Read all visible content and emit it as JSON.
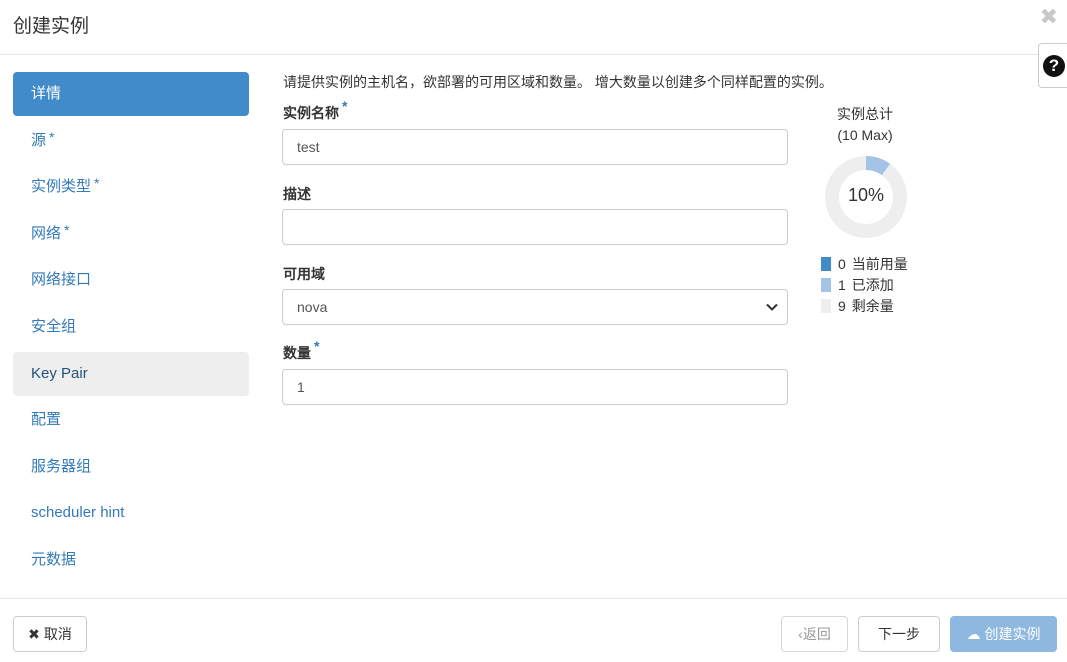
{
  "header": {
    "title": "创建实例",
    "close_symbol": "✖",
    "help_symbol": "?"
  },
  "nav": {
    "items": [
      {
        "label": "详情",
        "required": false,
        "state": "active"
      },
      {
        "label": "源",
        "required": true,
        "state": "normal"
      },
      {
        "label": "实例类型",
        "required": true,
        "state": "normal"
      },
      {
        "label": "网络",
        "required": true,
        "state": "normal"
      },
      {
        "label": "网络接口",
        "required": false,
        "state": "normal"
      },
      {
        "label": "安全组",
        "required": false,
        "state": "normal"
      },
      {
        "label": "Key Pair",
        "required": false,
        "state": "highlight"
      },
      {
        "label": "配置",
        "required": false,
        "state": "normal"
      },
      {
        "label": "服务器组",
        "required": false,
        "state": "normal"
      },
      {
        "label": "scheduler hint",
        "required": false,
        "state": "normal"
      },
      {
        "label": "元数据",
        "required": false,
        "state": "normal"
      }
    ],
    "required_mark": "*"
  },
  "form": {
    "intro": "请提供实例的主机名，欲部署的可用区域和数量。 增大数量以创建多个同样配置的实例。",
    "instance_name": {
      "label": "实例名称",
      "required": true,
      "value": "test"
    },
    "description": {
      "label": "描述",
      "required": false,
      "value": ""
    },
    "availability_zone": {
      "label": "可用域",
      "required": false,
      "value": "nova"
    },
    "count": {
      "label": "数量",
      "required": true,
      "value": "1"
    }
  },
  "quota": {
    "title": "实例总计",
    "max_text": "(10 Max)",
    "percent_text": "10%",
    "used_fraction": 0.0,
    "added_fraction": 0.1,
    "legend": [
      {
        "count": "0",
        "label": "当前用量",
        "color": "#428bca"
      },
      {
        "count": "1",
        "label": "已添加",
        "color": "#a3c4e6"
      },
      {
        "count": "9",
        "label": "剩余量",
        "color": "#eeeeee"
      }
    ]
  },
  "footer": {
    "cancel_label": "取消",
    "cancel_icon": "✖",
    "back_label": "‹返回",
    "next_label": "下一步",
    "launch_label": "创建实例",
    "launch_icon": "☁"
  },
  "colors": {
    "accent": "#428bca",
    "link": "#337ab7",
    "launch_disabled": "#8eb8e0"
  }
}
